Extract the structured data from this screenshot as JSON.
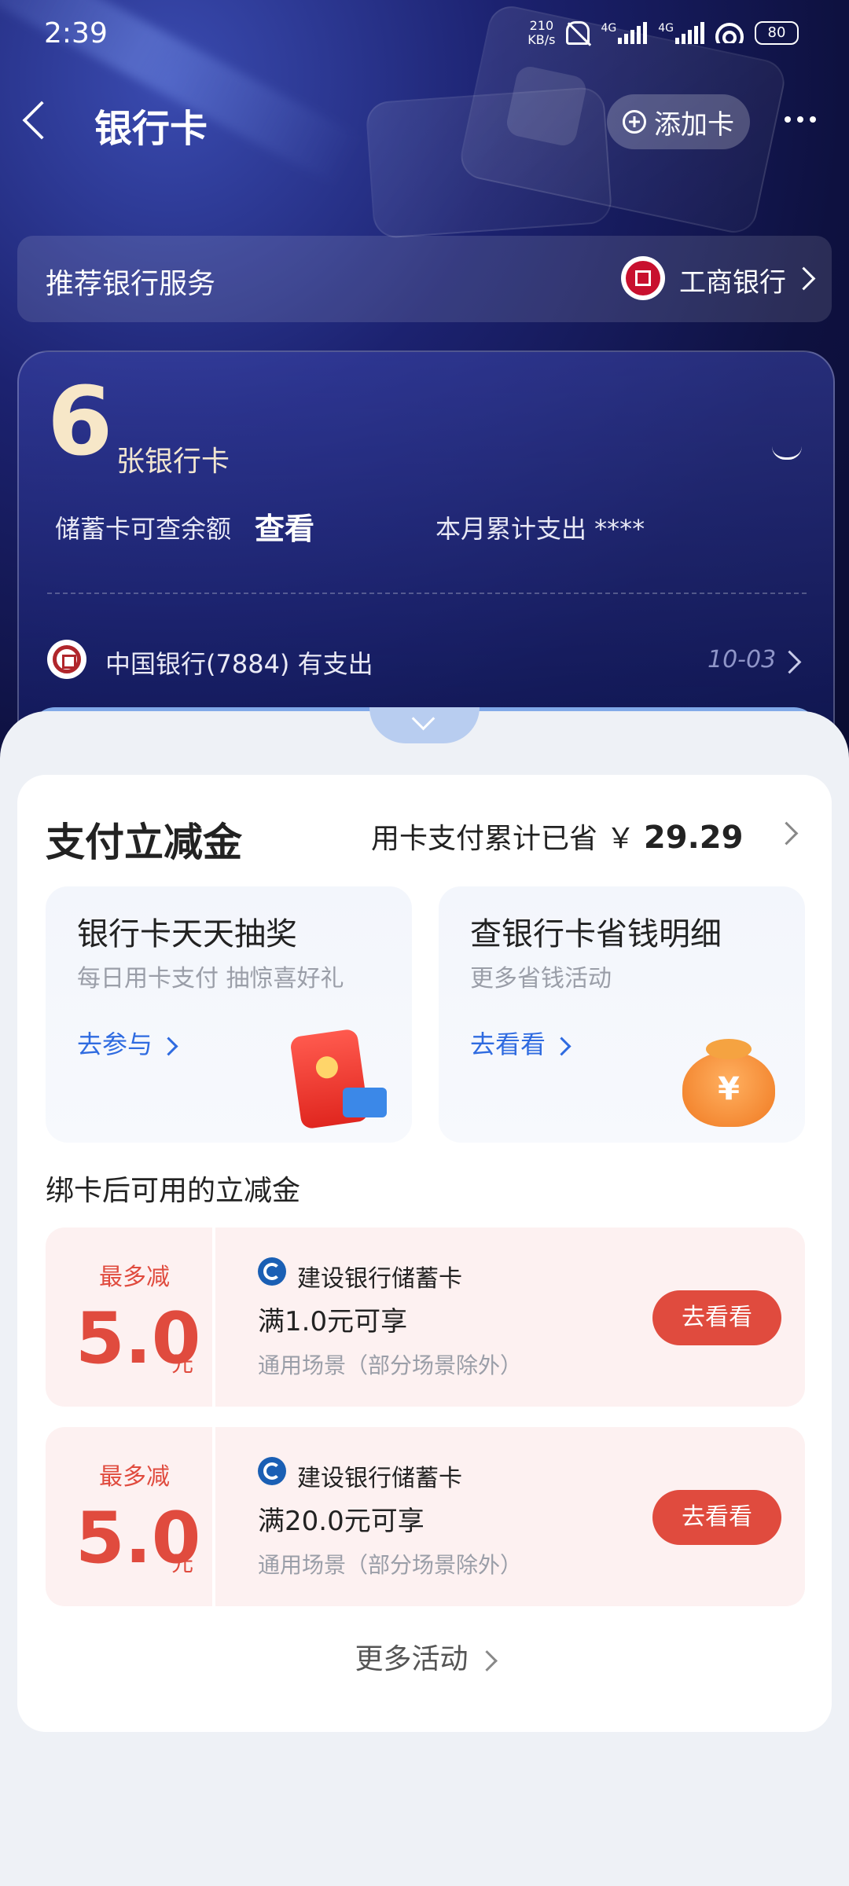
{
  "status_bar": {
    "time": "2:39",
    "net_speed": "210\nKB/s",
    "net_speed_top": "210",
    "net_speed_bottom": "KB/s",
    "sim1": "4G",
    "sim2": "4G",
    "battery": "80"
  },
  "header": {
    "title": "银行卡",
    "add_card_label": "添加卡"
  },
  "recommend": {
    "label": "推荐银行服务",
    "bank": "工商银行"
  },
  "summary": {
    "count": "6",
    "count_label": "张银行卡",
    "balance_label": "储蓄卡可查余额",
    "balance_link": "查看",
    "spend_label": "本月累计支出 ****",
    "transaction": "中国银行(7884) 有支出",
    "transaction_date": "10-03"
  },
  "discount": {
    "title": "支付立减金",
    "saved_prefix": "用卡支付累计已省 ￥",
    "saved_amount": "29.29"
  },
  "promos": [
    {
      "title": "银行卡天天抽奖",
      "subtitle": "每日用卡支付 抽惊喜好礼",
      "link": "去参与"
    },
    {
      "title": "查银行卡省钱明细",
      "subtitle": "更多省钱活动",
      "link": "去看看"
    }
  ],
  "section_title": "绑卡后可用的立减金",
  "coupons": [
    {
      "max_label": "最多减",
      "amount": "5.0",
      "unit": "元",
      "bank": "建设银行储蓄卡",
      "condition": "满1.0元可享",
      "scope": "通用场景（部分场景除外）",
      "action": "去看看"
    },
    {
      "max_label": "最多减",
      "amount": "5.0",
      "unit": "元",
      "bank": "建设银行储蓄卡",
      "condition": "满20.0元可享",
      "scope": "通用场景（部分场景除外）",
      "action": "去看看"
    }
  ],
  "more_label": "更多活动"
}
